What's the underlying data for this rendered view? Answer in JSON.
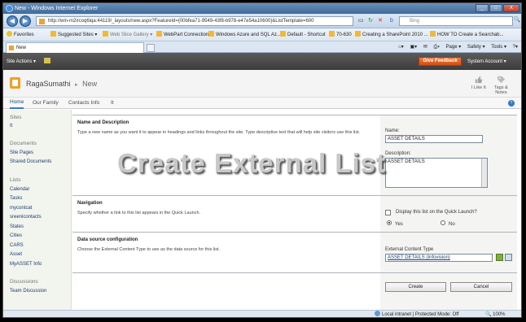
{
  "window": {
    "title": "New - Windows Internet Explorer",
    "controls": [
      "_",
      "□",
      "X"
    ]
  },
  "address_bar": {
    "url": "http://win-m2ircoq6iqa:44119/_layouts/new.aspx?FeatureId={00bfea71-9549-43f8-b978-e47e54a10600}&ListTemplate=600",
    "search_placeholder": "Bing"
  },
  "favorites_bar": {
    "items": [
      "Favorites",
      "Suggested Sites ▾",
      "Web Slice Gallery ▾",
      "WebPart Connection",
      "Windows Azure and SQL Az...",
      "Default - Shortcut",
      "70-630",
      "Creating a SharePoint 2010 ...",
      "HOW TO Create a Searchab..."
    ]
  },
  "tabs": {
    "active": "New",
    "commands": [
      "Page ▾",
      "Safety ▾",
      "Tools ▾",
      "?▾"
    ]
  },
  "ribbon": {
    "site_actions": "Site Actions ▾",
    "give_feedback": "Give Feedback",
    "account": "System Account ▾"
  },
  "header": {
    "site_name": "RagaSumathi",
    "separator": "▸",
    "page": "New",
    "i_like_it": "I Like It",
    "tags_notes_1": "Tags &",
    "tags_notes_2": "Notes"
  },
  "top_nav": {
    "items": [
      "Home",
      "Our Family",
      "Contacts Info",
      "It"
    ],
    "help": "?"
  },
  "quick_launch": {
    "groups": [
      {
        "heading": "Sites",
        "items": [
          "It"
        ]
      },
      {
        "heading": "Documents",
        "items": [
          "Site Pages",
          "Shared Documents"
        ]
      },
      {
        "heading": "Lists",
        "items": [
          "Calendar",
          "Tasks",
          "mycontcat",
          "sreenicontacts",
          "States",
          "Cities",
          "CARS",
          "Asset",
          "MyASSET Info"
        ]
      },
      {
        "heading": "Discussions",
        "items": [
          "Team Discussion"
        ]
      }
    ]
  },
  "form": {
    "name_section": {
      "title": "Name and Description",
      "description": "Type a new name as you want it to appear in headings and links throughout the site. Type descriptive text that will help site visitors use this list.",
      "name_label": "Name:",
      "name_value": "ASSET DETAILS",
      "description_label": "Description:",
      "description_value": "ASSET DETAILS"
    },
    "navigation_section": {
      "title": "Navigation",
      "description": "Specify whether a link to this list appears in the Quick Launch.",
      "question": "Display this list on the Quick Launch?",
      "yes": "Yes",
      "no": "No",
      "selected": "Yes"
    },
    "datasource_section": {
      "title": "Data source configuration",
      "description": "Choose the External Content Type to use as the data source for this list.",
      "ect_label": "External Content Type",
      "ect_value": "ASSET DETAILS (Infovision)"
    },
    "buttons": {
      "create": "Create",
      "cancel": "Cancel"
    }
  },
  "overlay_caption": "Create External List",
  "status_bar": {
    "zone": "Local intranet | Protected Mode: Off",
    "zoom": "100%"
  }
}
